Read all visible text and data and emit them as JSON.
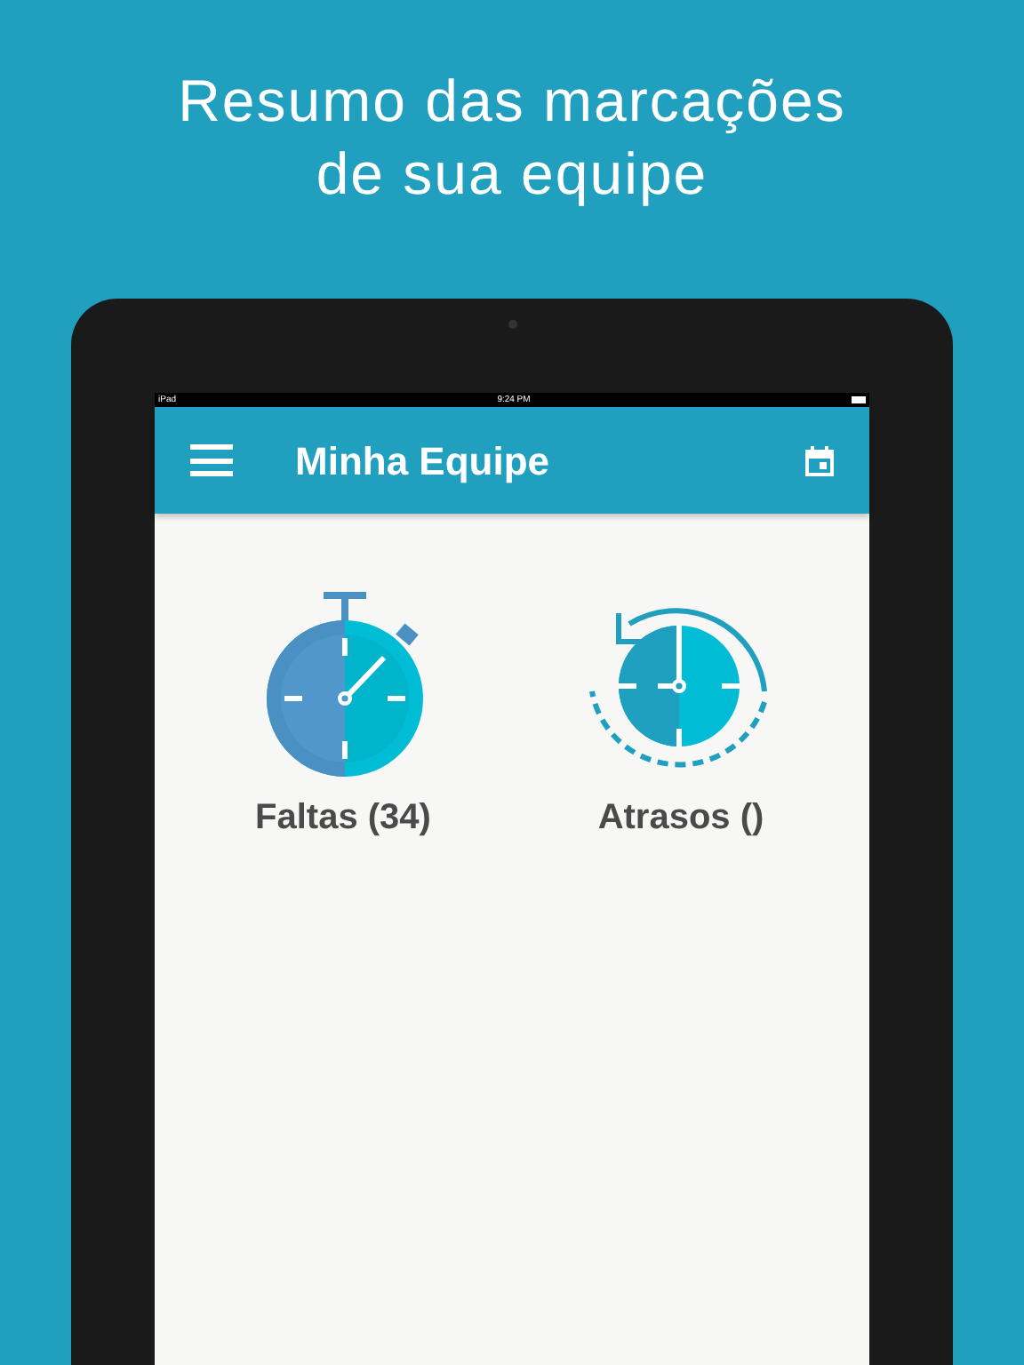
{
  "headline": "Resumo das marcações de sua equipe",
  "status_bar": {
    "device": "iPad",
    "time": "9:24 PM"
  },
  "app_bar": {
    "title": "Minha Equipe"
  },
  "items": [
    {
      "kind": "stopwatch",
      "label": "Faltas (34)"
    },
    {
      "kind": "history",
      "label": "Atrasos ()"
    }
  ]
}
